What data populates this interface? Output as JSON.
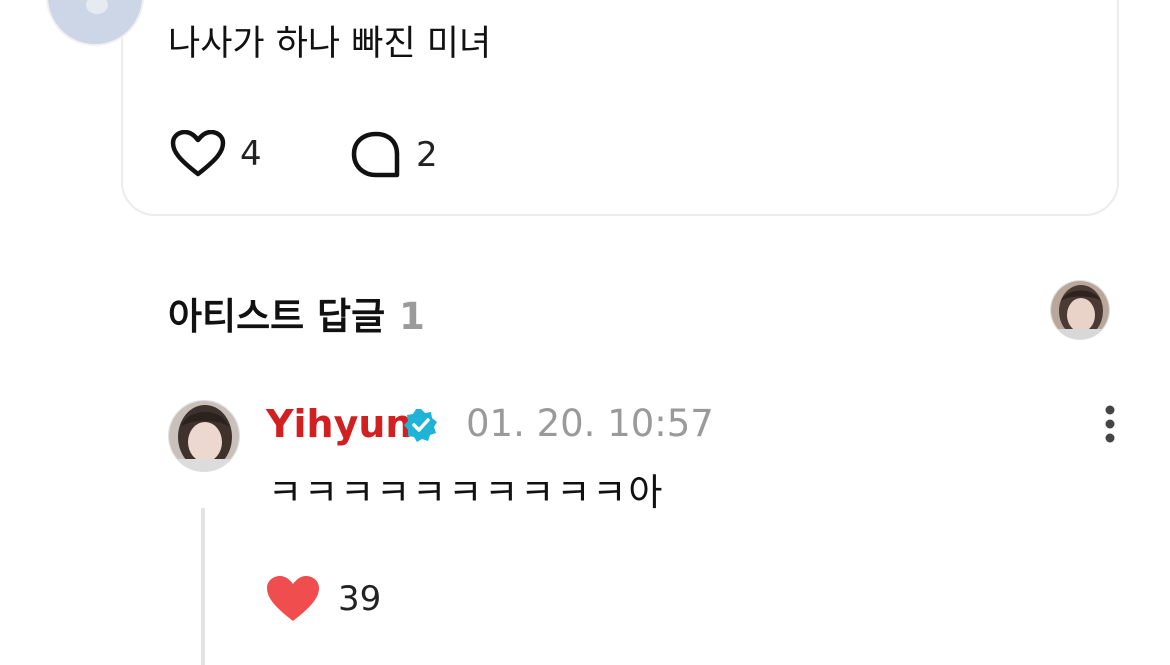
{
  "post": {
    "text": "나사가 하나 빠진 미녀",
    "like_count": "4",
    "comment_count": "2"
  },
  "artist_replies": {
    "title": "아티스트 답글",
    "count": "1"
  },
  "reply": {
    "author": "Yihyun",
    "verified_icon": "verified-badge-icon",
    "timestamp": "01. 20. 10:57",
    "text": "ㅋㅋㅋㅋㅋㅋㅋㅋㅋㅋ아",
    "like_count": "39",
    "like_icon": "filled-heart-icon",
    "more_icon": "more-vertical-icon"
  },
  "colors": {
    "author_name": "#d21f1f",
    "verified_badge": "#1fb3d8",
    "liked_heart": "#f04e4e",
    "muted_text": "#9a9a9a"
  }
}
